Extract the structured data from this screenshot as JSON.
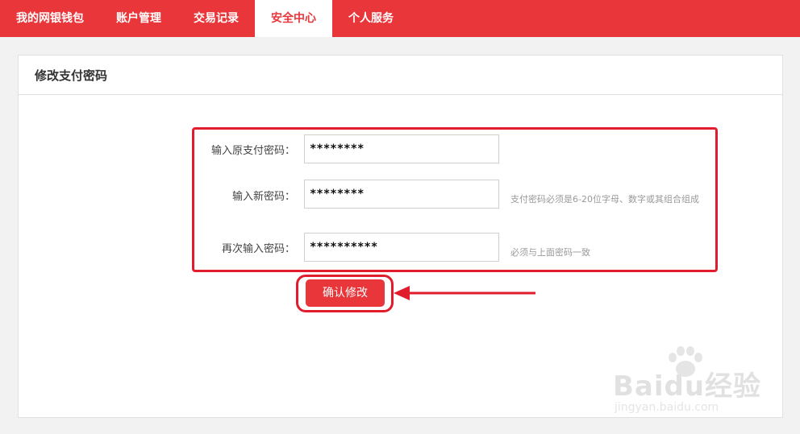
{
  "nav": {
    "tabs": [
      {
        "label": "我的网银钱包"
      },
      {
        "label": "账户管理"
      },
      {
        "label": "交易记录"
      },
      {
        "label": "安全中心"
      },
      {
        "label": "个人服务"
      }
    ],
    "active_index": 3
  },
  "panel": {
    "title": "修改支付密码"
  },
  "form": {
    "old_pw_label": "输入原支付密码：",
    "old_pw_value": "********",
    "new_pw_label": "输入新密码：",
    "new_pw_value": "********",
    "new_pw_hint": "支付密码必须是6-20位字母、数字或其组合组成",
    "confirm_pw_label": "再次输入密码：",
    "confirm_pw_value": "**********",
    "confirm_pw_hint": "必须与上面密码一致"
  },
  "actions": {
    "confirm_label": "确认修改"
  },
  "watermark": {
    "brand": "Baidu经验",
    "url": "jingyan.baidu.com"
  },
  "colors": {
    "brand_red": "#e8363b",
    "annotation_red": "#e11d2d"
  }
}
